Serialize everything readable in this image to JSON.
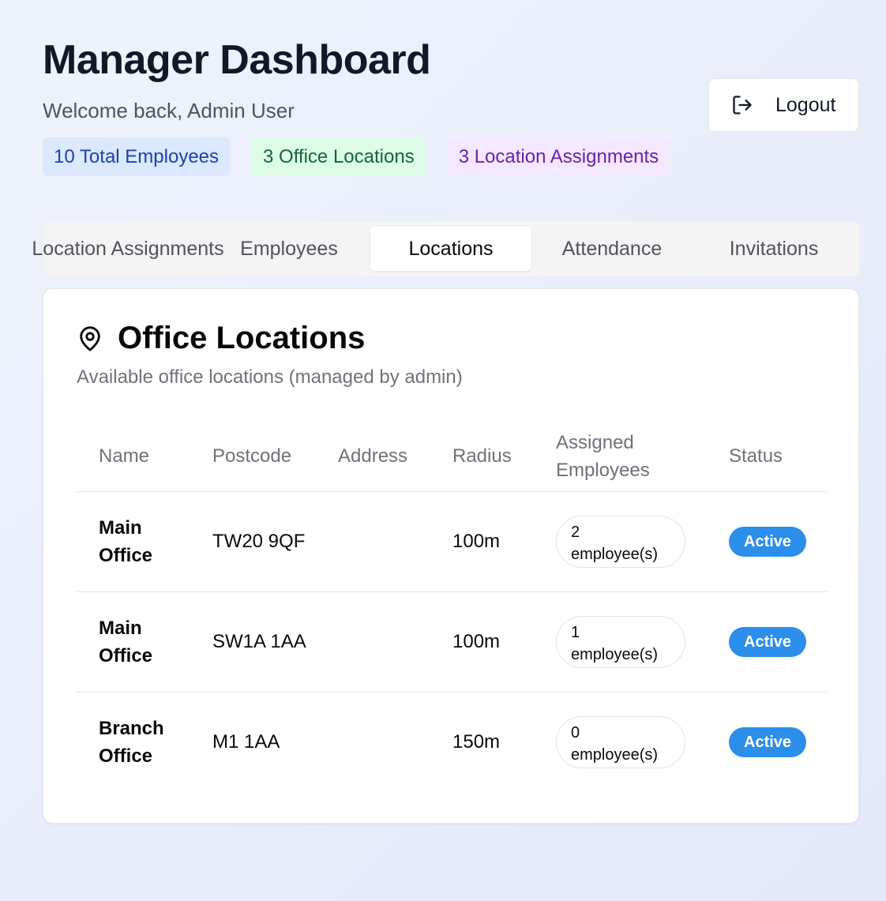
{
  "header": {
    "title": "Manager Dashboard",
    "subtitle": "Welcome back, Admin User",
    "badges": [
      {
        "label": "10 Total Employees"
      },
      {
        "label": "3 Office Locations"
      },
      {
        "label": "3 Location Assignments"
      }
    ],
    "logout_label": "Logout"
  },
  "tabs": [
    {
      "label": "Location Assignments"
    },
    {
      "label": "Employees"
    },
    {
      "label": "Locations"
    },
    {
      "label": "Attendance"
    },
    {
      "label": "Invitations"
    }
  ],
  "active_tab": "Locations",
  "card": {
    "title": "Office Locations",
    "description": "Available office locations (managed by admin)",
    "icon": "map-pin-icon"
  },
  "table": {
    "headers": [
      "Name",
      "Postcode",
      "Address",
      "Radius",
      "Assigned Employees",
      "Status"
    ],
    "rows": [
      {
        "name": "Main Office",
        "postcode": "TW20 9QF",
        "address": "",
        "radius": "100m",
        "assigned": "2 employee(s)",
        "status": "Active"
      },
      {
        "name": "Main Office",
        "postcode": "SW1A 1AA",
        "address": "",
        "radius": "100m",
        "assigned": "1 employee(s)",
        "status": "Active"
      },
      {
        "name": "Branch Office",
        "postcode": "M1 1AA",
        "address": "",
        "radius": "150m",
        "assigned": "0 employee(s)",
        "status": "Active"
      }
    ]
  },
  "colors": {
    "status_active": "#2b8eea",
    "badge_blue": "#dbe8fe",
    "badge_green": "#dcfce7",
    "badge_purple": "#f3e8ff"
  }
}
